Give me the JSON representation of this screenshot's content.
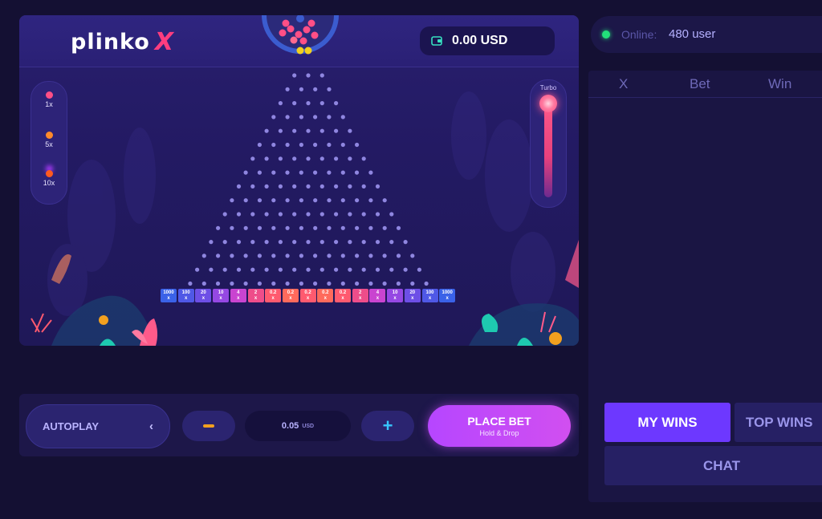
{
  "game": {
    "logo_word": "plinko",
    "logo_x": "X",
    "balance": "0.00 USD",
    "multipliers": [
      {
        "label": "1x",
        "color": "#ff4f86"
      },
      {
        "label": "5x",
        "color": "#ff8a2a"
      },
      {
        "label": "10x",
        "color": "#ff5a1f"
      }
    ],
    "turbo_label": "Turbo",
    "slots": [
      {
        "value": "1000",
        "suffix": "x",
        "color": "#3a62e8"
      },
      {
        "value": "100",
        "suffix": "x",
        "color": "#4f58e6"
      },
      {
        "value": "20",
        "suffix": "x",
        "color": "#6d4fe6"
      },
      {
        "value": "10",
        "suffix": "x",
        "color": "#9548e3"
      },
      {
        "value": "4",
        "suffix": "x",
        "color": "#c944d0"
      },
      {
        "value": "2",
        "suffix": "x",
        "color": "#ee4d8a"
      },
      {
        "value": "0.2",
        "suffix": "x",
        "color": "#ff5a6f"
      },
      {
        "value": "0.2",
        "suffix": "x",
        "color": "#ff6a5c"
      },
      {
        "value": "0.2",
        "suffix": "x",
        "color": "#ff5a6f"
      },
      {
        "value": "0.2",
        "suffix": "x",
        "color": "#ff6a5c"
      },
      {
        "value": "0.2",
        "suffix": "x",
        "color": "#ff5a6f"
      },
      {
        "value": "2",
        "suffix": "x",
        "color": "#ee4d8a"
      },
      {
        "value": "4",
        "suffix": "x",
        "color": "#c944d0"
      },
      {
        "value": "10",
        "suffix": "x",
        "color": "#9548e3"
      },
      {
        "value": "20",
        "suffix": "x",
        "color": "#6d4fe6"
      },
      {
        "value": "100",
        "suffix": "x",
        "color": "#4f58e6"
      },
      {
        "value": "1000",
        "suffix": "x",
        "color": "#3a62e8"
      }
    ],
    "peg_rows": 16
  },
  "controls": {
    "autoplay": "AUTOPLAY",
    "bet_value": "0.05",
    "bet_currency": "USD",
    "place_bet": "PLACE BET",
    "place_bet_sub": "Hold & Drop"
  },
  "sidebar": {
    "online_label": "Online:",
    "online_count": "480 user",
    "columns": [
      "X",
      "Bet",
      "Win"
    ],
    "tabs": {
      "my_wins": "MY WINS",
      "top_wins": "TOP WINS",
      "chat": "CHAT"
    }
  },
  "colors": {
    "accent": "#6d38ff",
    "place_bet": "#c44cf8",
    "online": "#22e07a"
  }
}
